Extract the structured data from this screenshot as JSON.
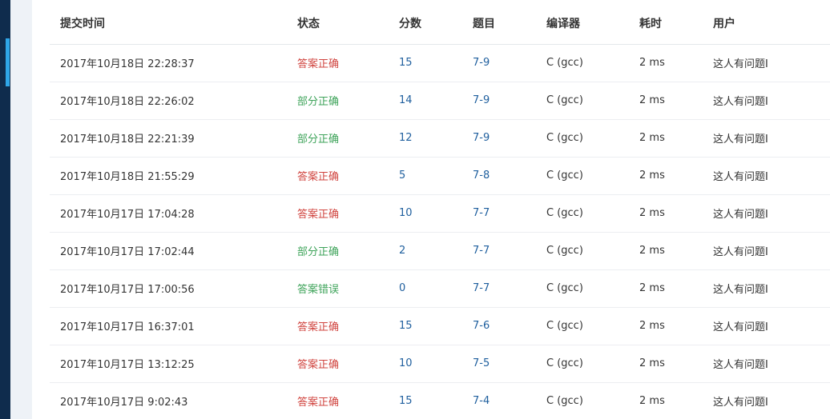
{
  "table": {
    "headers": [
      "提交时间",
      "状态",
      "分数",
      "题目",
      "编译器",
      "耗时",
      "用户"
    ],
    "rows": [
      {
        "time": "2017年10月18日 22:28:37",
        "status": "答案正确",
        "status_kind": "ok",
        "score": "15",
        "problem": "7-9",
        "compiler": "C (gcc)",
        "duration": "2 ms",
        "user": "这人有问题I"
      },
      {
        "time": "2017年10月18日 22:26:02",
        "status": "部分正确",
        "status_kind": "partial",
        "score": "14",
        "problem": "7-9",
        "compiler": "C (gcc)",
        "duration": "2 ms",
        "user": "这人有问题I"
      },
      {
        "time": "2017年10月18日 22:21:39",
        "status": "部分正确",
        "status_kind": "partial",
        "score": "12",
        "problem": "7-9",
        "compiler": "C (gcc)",
        "duration": "2 ms",
        "user": "这人有问题I"
      },
      {
        "time": "2017年10月18日 21:55:29",
        "status": "答案正确",
        "status_kind": "ok",
        "score": "5",
        "problem": "7-8",
        "compiler": "C (gcc)",
        "duration": "2 ms",
        "user": "这人有问题I"
      },
      {
        "time": "2017年10月17日 17:04:28",
        "status": "答案正确",
        "status_kind": "ok",
        "score": "10",
        "problem": "7-7",
        "compiler": "C (gcc)",
        "duration": "2 ms",
        "user": "这人有问题I"
      },
      {
        "time": "2017年10月17日 17:02:44",
        "status": "部分正确",
        "status_kind": "partial",
        "score": "2",
        "problem": "7-7",
        "compiler": "C (gcc)",
        "duration": "2 ms",
        "user": "这人有问题I"
      },
      {
        "time": "2017年10月17日 17:00:56",
        "status": "答案错误",
        "status_kind": "wrong",
        "score": "0",
        "problem": "7-7",
        "compiler": "C (gcc)",
        "duration": "2 ms",
        "user": "这人有问题I"
      },
      {
        "time": "2017年10月17日 16:37:01",
        "status": "答案正确",
        "status_kind": "ok",
        "score": "15",
        "problem": "7-6",
        "compiler": "C (gcc)",
        "duration": "2 ms",
        "user": "这人有问题I"
      },
      {
        "time": "2017年10月17日 13:12:25",
        "status": "答案正确",
        "status_kind": "ok",
        "score": "10",
        "problem": "7-5",
        "compiler": "C (gcc)",
        "duration": "2 ms",
        "user": "这人有问题I"
      },
      {
        "time": "2017年10月17日 9:02:43",
        "status": "答案正确",
        "status_kind": "ok",
        "score": "15",
        "problem": "7-4",
        "compiler": "C (gcc)",
        "duration": "2 ms",
        "user": "这人有问题I"
      }
    ]
  },
  "colors": {
    "sidebar": "#0f2c4d",
    "sidebar_accent": "#2fa6e8",
    "status_ok": "#d0443f",
    "status_partial": "#3ea35a",
    "status_wrong": "#3ea35a",
    "link": "#1f5f9e"
  }
}
